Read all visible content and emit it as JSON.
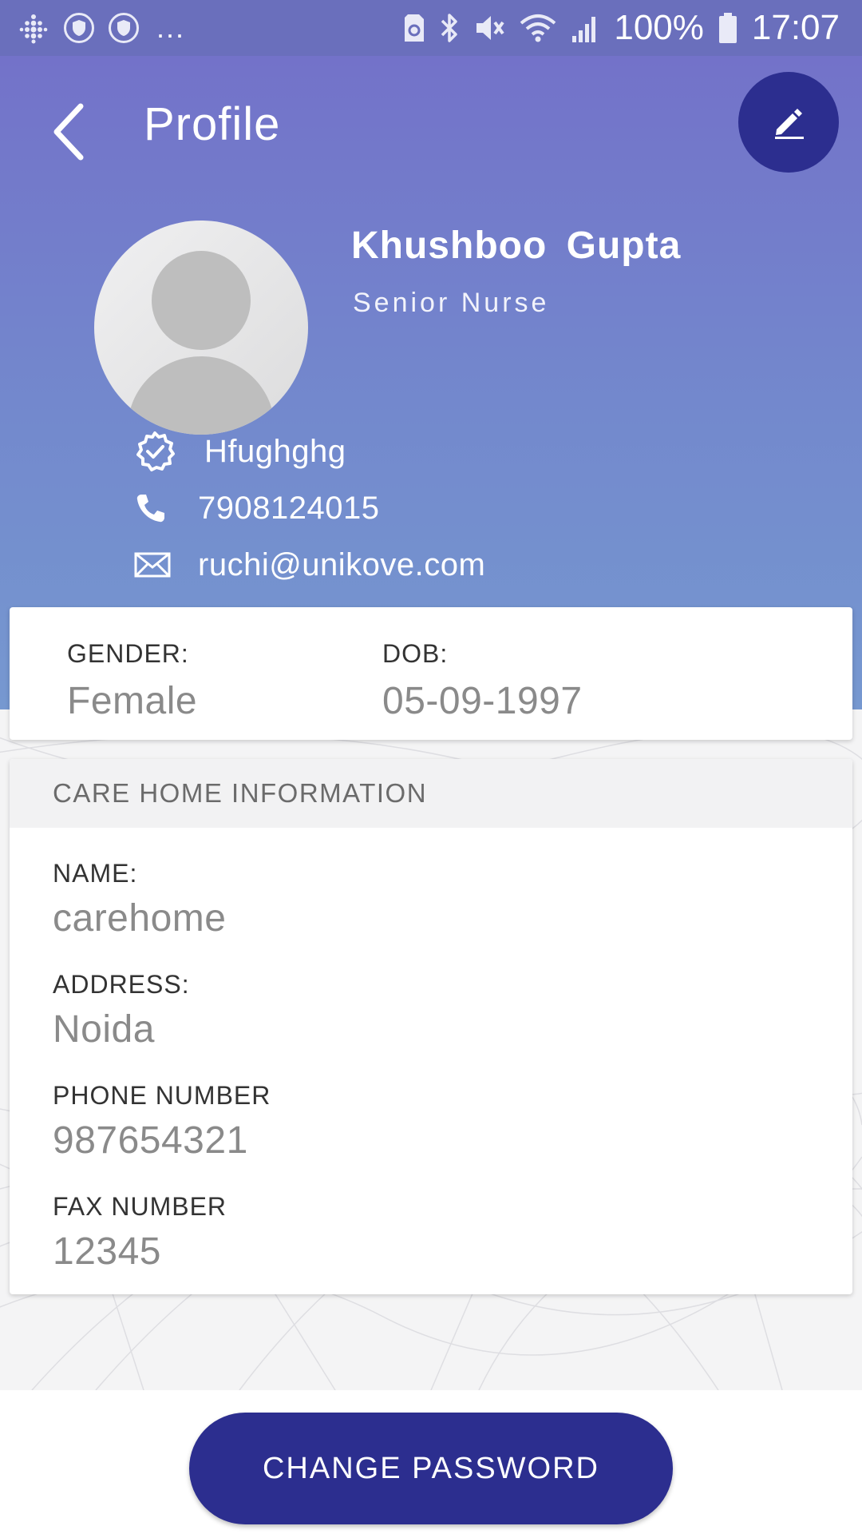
{
  "status_bar": {
    "dots": "...",
    "battery_percent": "100%",
    "time": "17:07"
  },
  "header": {
    "title": "Profile"
  },
  "profile": {
    "name": "Khushboo  Gupta",
    "role": "Senior Nurse",
    "badge_text": "Hfughghg",
    "phone": "7908124015",
    "email": "ruchi@unikove.com"
  },
  "basic_info": {
    "gender_label": "GENDER:",
    "gender_value": "Female",
    "dob_label": "DOB:",
    "dob_value": "05-09-1997"
  },
  "care_home": {
    "section_title": "CARE HOME INFORMATION",
    "name_label": "NAME:",
    "name_value": "carehome",
    "address_label": "ADDRESS:",
    "address_value": "Noida",
    "phone_label": "PHONE NUMBER",
    "phone_value": "987654321",
    "fax_label": "FAX NUMBER",
    "fax_value": "12345"
  },
  "actions": {
    "change_password_label": "CHANGE PASSWORD"
  },
  "colors": {
    "primary": "#2c2e8f",
    "header_gradient_top": "#7372c9",
    "header_gradient_bottom": "#7698d0"
  }
}
